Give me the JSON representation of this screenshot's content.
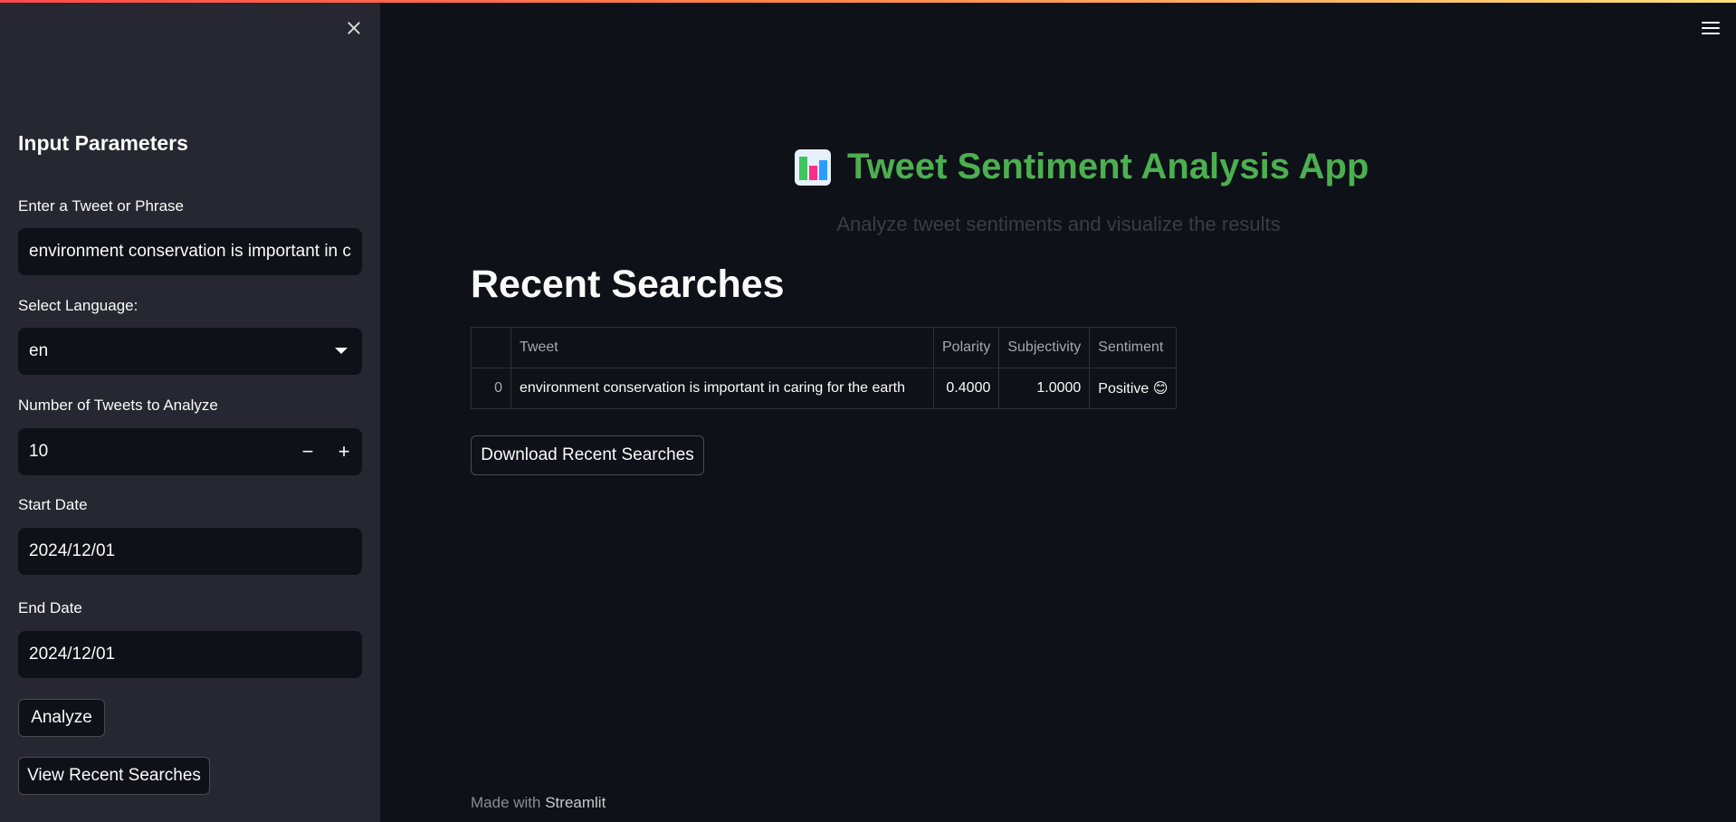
{
  "sidebar": {
    "header": "Input Parameters",
    "tweet_label": "Enter a Tweet or Phrase",
    "tweet_value": "environment conservation is important in c",
    "language_label": "Select Language:",
    "language_value": "en",
    "num_label": "Number of Tweets to Analyze",
    "num_value": "10",
    "minus": "−",
    "plus": "+",
    "start_label": "Start Date",
    "start_value": "2024/12/01",
    "end_label": "End Date",
    "end_value": "2024/12/01",
    "analyze_button": "Analyze",
    "recent_button": "View Recent Searches"
  },
  "main": {
    "title": "Tweet Sentiment Analysis App",
    "subtitle": "Analyze tweet sentiments and visualize the results",
    "section_title": "Recent Searches",
    "table": {
      "columns": [
        "",
        "Tweet",
        "Polarity",
        "Subjectivity",
        "Sentiment"
      ],
      "rows": [
        {
          "index": "0",
          "tweet": "environment conservation is important in caring for the earth",
          "polarity": "0.4000",
          "subjectivity": "1.0000",
          "sentiment": "Positive 😊"
        }
      ]
    },
    "download_button": "Download Recent Searches",
    "footer_prefix": "Made with",
    "footer_link": "Streamlit"
  },
  "colors": {
    "background": "#0e1117",
    "sidebar": "#262730",
    "title_green": "#4caf50"
  },
  "icons": {
    "close": "close-icon",
    "menu": "hamburger-menu-icon",
    "title": "bar-chart-icon",
    "dropdown": "chevron-down-icon"
  }
}
